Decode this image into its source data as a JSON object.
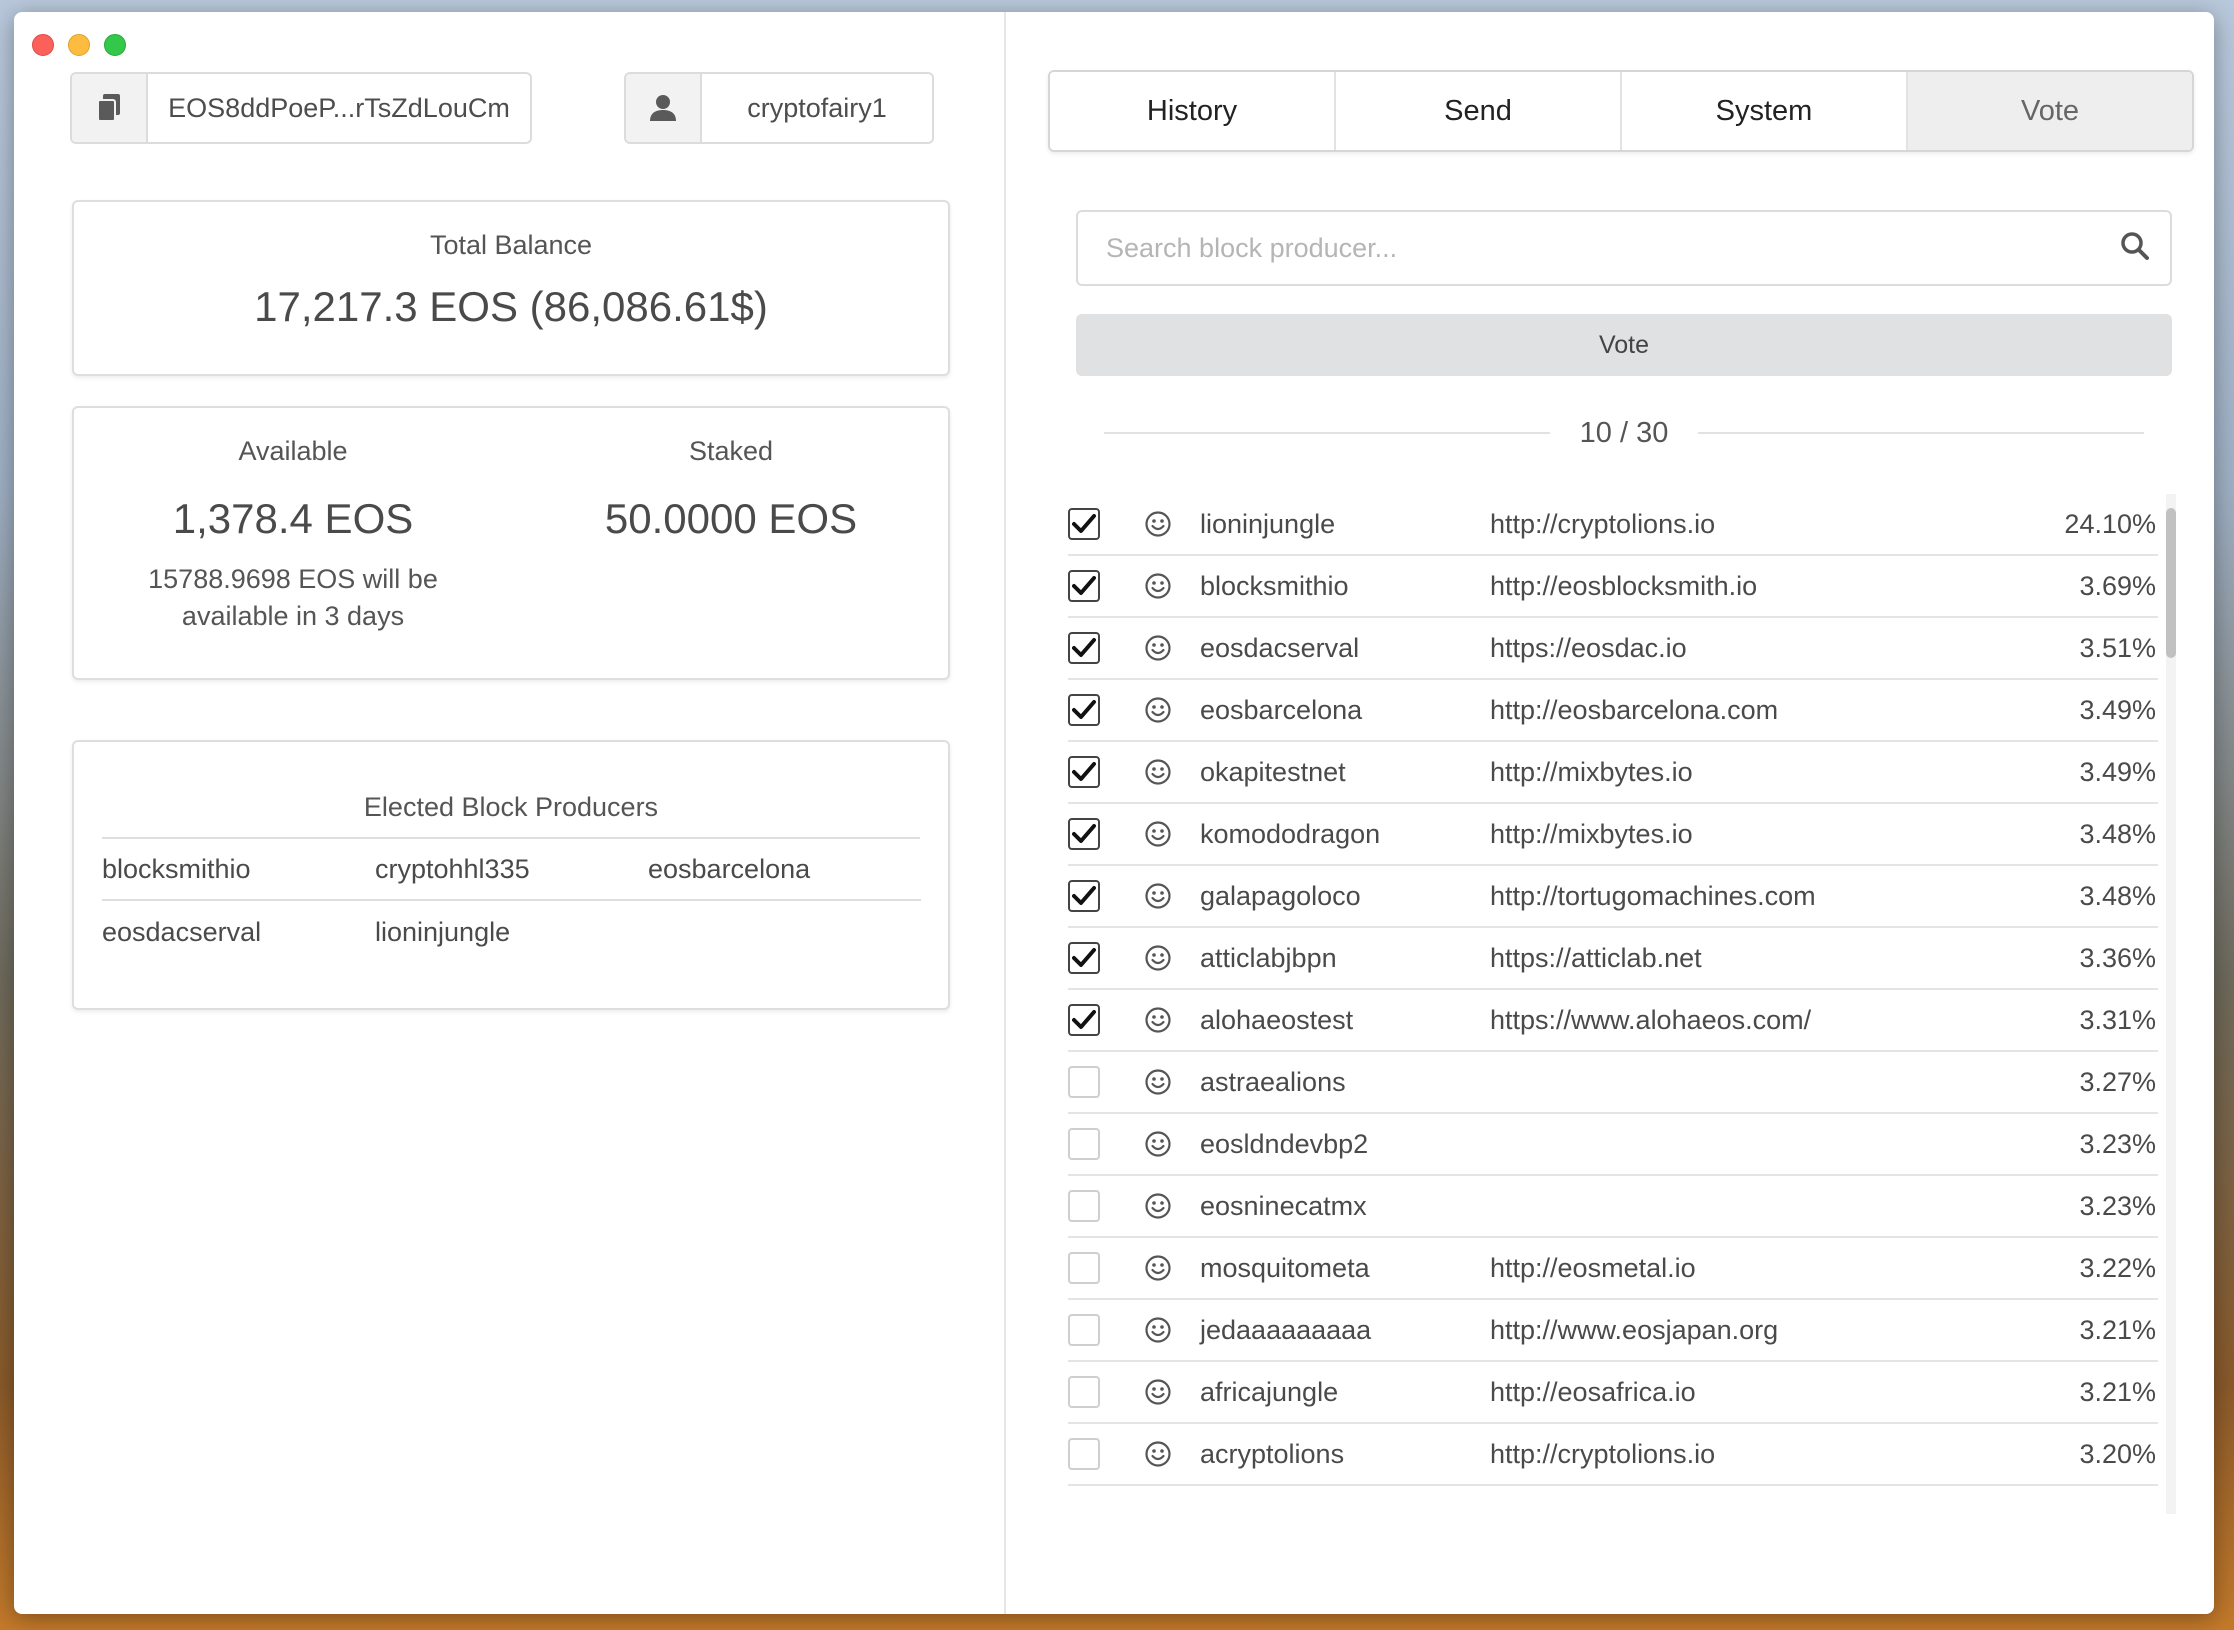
{
  "header": {
    "public_key": "EOS8ddPoeP...rTsZdLouCm",
    "account": "cryptofairy1"
  },
  "balance": {
    "total_label": "Total Balance",
    "total_value": "17,217.3 EOS (86,086.61$)",
    "available_label": "Available",
    "available_value": "1,378.4 EOS",
    "unstaking_note": "15788.9698 EOS will be available in 3 days",
    "staked_label": "Staked",
    "staked_value": "50.0000 EOS"
  },
  "elected": {
    "title": "Elected Block Producers",
    "producers": [
      "blocksmithio",
      "cryptohhl335",
      "eosbarcelona",
      "eosdacserval",
      "lioninjungle"
    ]
  },
  "tabs": [
    {
      "label": "History",
      "active": false
    },
    {
      "label": "Send",
      "active": false
    },
    {
      "label": "System",
      "active": false
    },
    {
      "label": "Vote",
      "active": true
    }
  ],
  "vote": {
    "search_placeholder": "Search block producer...",
    "button_label": "Vote",
    "counter": "10 / 30"
  },
  "producers": [
    {
      "name": "lioninjungle",
      "url": "http://cryptolions.io",
      "percent": "24.10%",
      "checked": true
    },
    {
      "name": "blocksmithio",
      "url": "http://eosblocksmith.io",
      "percent": "3.69%",
      "checked": true
    },
    {
      "name": "eosdacserval",
      "url": "https://eosdac.io",
      "percent": "3.51%",
      "checked": true
    },
    {
      "name": "eosbarcelona",
      "url": "http://eosbarcelona.com",
      "percent": "3.49%",
      "checked": true
    },
    {
      "name": "okapitestnet",
      "url": "http://mixbytes.io",
      "percent": "3.49%",
      "checked": true
    },
    {
      "name": "komododragon",
      "url": "http://mixbytes.io",
      "percent": "3.48%",
      "checked": true
    },
    {
      "name": "galapagoloco",
      "url": "http://tortugomachines.com",
      "percent": "3.48%",
      "checked": true
    },
    {
      "name": "atticlabjbpn",
      "url": "https://atticlab.net",
      "percent": "3.36%",
      "checked": true
    },
    {
      "name": "alohaeostest",
      "url": "https://www.alohaeos.com/",
      "percent": "3.31%",
      "checked": true
    },
    {
      "name": "astraealions",
      "url": "",
      "percent": "3.27%",
      "checked": false
    },
    {
      "name": "eosldndevbp2",
      "url": "",
      "percent": "3.23%",
      "checked": false
    },
    {
      "name": "eosninecatmx",
      "url": "",
      "percent": "3.23%",
      "checked": false
    },
    {
      "name": "mosquitometa",
      "url": "http://eosmetal.io",
      "percent": "3.22%",
      "checked": false
    },
    {
      "name": "jedaaaaaaaaa",
      "url": "http://www.eosjapan.org",
      "percent": "3.21%",
      "checked": false
    },
    {
      "name": "africajungle",
      "url": "http://eosafrica.io",
      "percent": "3.21%",
      "checked": false
    },
    {
      "name": "acryptolions",
      "url": "http://cryptolions.io",
      "percent": "3.20%",
      "checked": false
    }
  ]
}
